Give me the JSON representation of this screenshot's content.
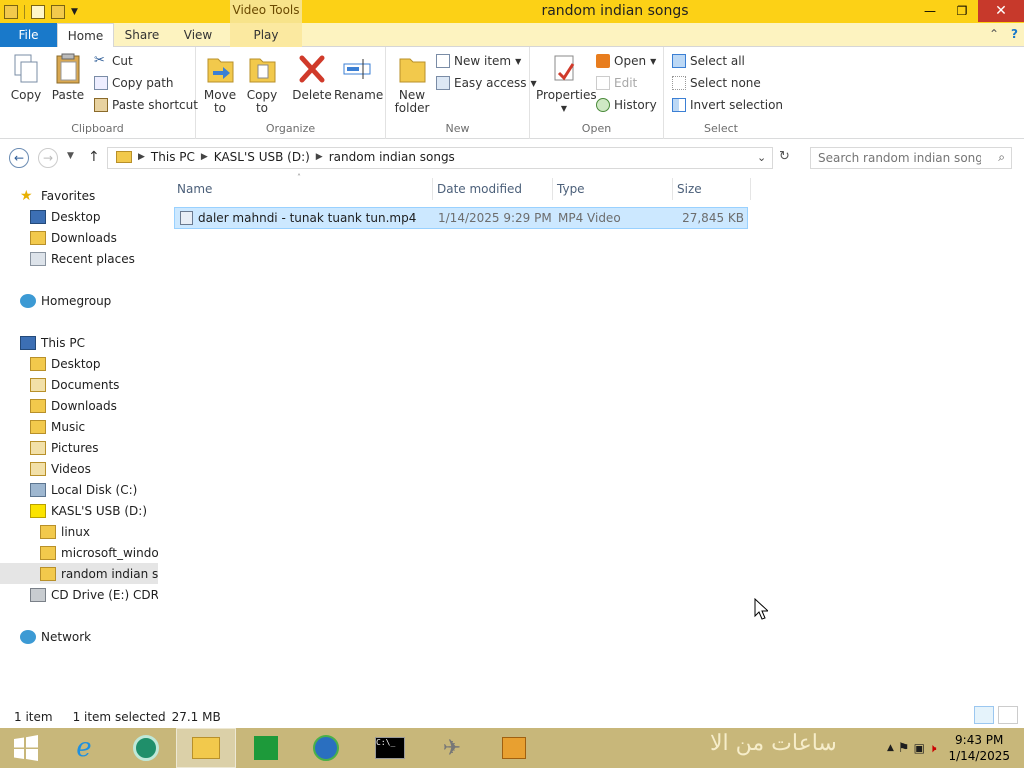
{
  "window": {
    "title": "random indian songs",
    "context_tab_group": "Video Tools",
    "minimize_label": "—",
    "maximize_label": "❐",
    "close_label": "✕"
  },
  "tabs": {
    "file": "File",
    "home": "Home",
    "share": "Share",
    "view": "View",
    "play": "Play"
  },
  "ribbon": {
    "clipboard": {
      "label": "Clipboard",
      "copy": "Copy",
      "paste": "Paste",
      "cut": "Cut",
      "copy_path": "Copy path",
      "paste_shortcut": "Paste shortcut"
    },
    "organize": {
      "label": "Organize",
      "move_to_1": "Move",
      "move_to_2": "to",
      "copy_to_1": "Copy",
      "copy_to_2": "to",
      "delete": "Delete",
      "rename": "Rename"
    },
    "new": {
      "label": "New",
      "new_folder_1": "New",
      "new_folder_2": "folder",
      "new_item": "New item",
      "easy_access": "Easy access"
    },
    "open": {
      "label": "Open",
      "properties": "Properties",
      "open": "Open",
      "edit": "Edit",
      "history": "History"
    },
    "select": {
      "label": "Select",
      "select_all": "Select all",
      "select_none": "Select none",
      "invert_selection": "Invert selection"
    }
  },
  "address": {
    "crumbs": [
      "This PC",
      "KASL'S USB (D:)",
      "random indian songs"
    ],
    "search_placeholder": "Search random indian songs"
  },
  "nav": {
    "favorites": "Favorites",
    "fav_items": [
      "Desktop",
      "Downloads",
      "Recent places"
    ],
    "homegroup": "Homegroup",
    "this_pc": "This PC",
    "pc_items": [
      "Desktop",
      "Documents",
      "Downloads",
      "Music",
      "Pictures",
      "Videos",
      "Local Disk (C:)",
      "KASL'S USB (D:)"
    ],
    "usb_items": [
      "linux",
      "microsoft_window",
      "random indian sor"
    ],
    "cd_drive": "CD Drive (E:) CDRON",
    "network": "Network"
  },
  "columns": {
    "name": "Name",
    "date": "Date modified",
    "type": "Type",
    "size": "Size"
  },
  "files": [
    {
      "name": "daler mahndi - tunak tuank tun.mp4",
      "date": "1/14/2025 9:29 PM",
      "type": "MP4 Video",
      "size": "27,845 KB"
    }
  ],
  "status": {
    "count": "1 item",
    "selected": "1 item selected",
    "size": "27.1 MB"
  },
  "taskbar": {
    "wallpaper_text": "ساعات من الا",
    "time": "9:43 PM",
    "date": "1/14/2025"
  },
  "colors": {
    "title_bar": "#fcd116",
    "file_tab": "#1979ca",
    "selection": "#cce8ff",
    "close": "#c7392b"
  }
}
